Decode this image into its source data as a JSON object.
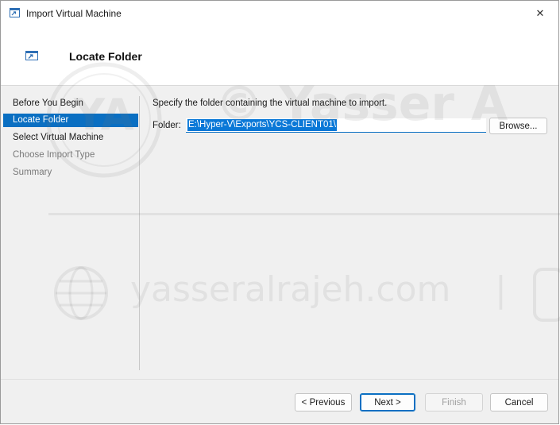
{
  "window": {
    "title": "Import Virtual Machine",
    "close_glyph": "✕"
  },
  "header": {
    "title": "Locate Folder"
  },
  "nav": {
    "items": [
      {
        "label": "Before You Begin",
        "state": "done"
      },
      {
        "label": "Locate Folder",
        "state": "active"
      },
      {
        "label": "Select Virtual Machine",
        "state": "done"
      },
      {
        "label": "Choose Import Type",
        "state": "disabled"
      },
      {
        "label": "Summary",
        "state": "disabled"
      }
    ]
  },
  "main": {
    "description": "Specify the folder containing the virtual machine to import.",
    "folder_label": "Folder:",
    "folder_value": "E:\\Hyper-V\\Exports\\YCS-CLIENT01\\",
    "browse_label": "Browse..."
  },
  "footer": {
    "previous_label": "< Previous",
    "next_label": "Next >",
    "finish_label": "Finish",
    "cancel_label": "Cancel"
  },
  "watermark": {
    "brand": "© Yasser A",
    "site": "yasseralrajeh.com",
    "separator": "|",
    "initials": "YA"
  },
  "colors": {
    "accent": "#0a6fc2",
    "selection": "#0a78d7"
  },
  "icons": {
    "title": "import-vm-icon",
    "header": "import-vm-icon",
    "close": "close-icon"
  }
}
